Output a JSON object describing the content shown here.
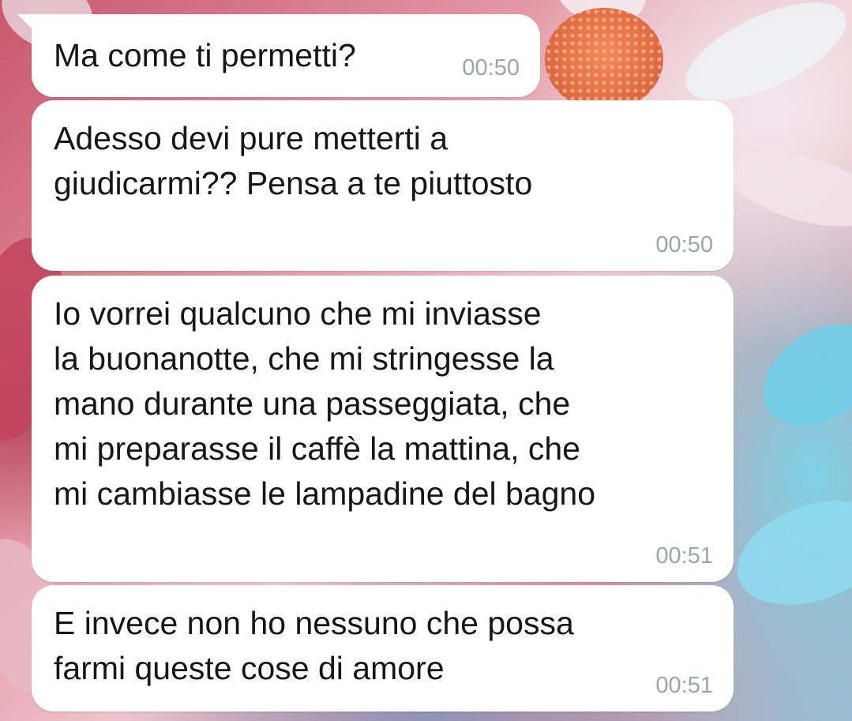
{
  "messages": [
    {
      "text": "Ma come ti permetti?",
      "time": "00:50"
    },
    {
      "text": "Adesso devi pure metterti a\ngiudicarmi?? Pensa a te piuttosto",
      "time": "00:50"
    },
    {
      "text": "Io vorrei qualcuno che mi inviasse\nla buonanotte, che mi stringesse la\nmano durante una passeggiata, che\nmi preparasse il caffè la mattina, che\nmi cambiasse le lampadine del bagno",
      "time": "00:51"
    },
    {
      "text": "E invece non ho nessuno che possa\nfarmi queste cose di amore",
      "time": "00:51"
    }
  ],
  "colors": {
    "bubble": "#ffffff",
    "text": "#161616",
    "timestamp": "#9ea3a8"
  }
}
